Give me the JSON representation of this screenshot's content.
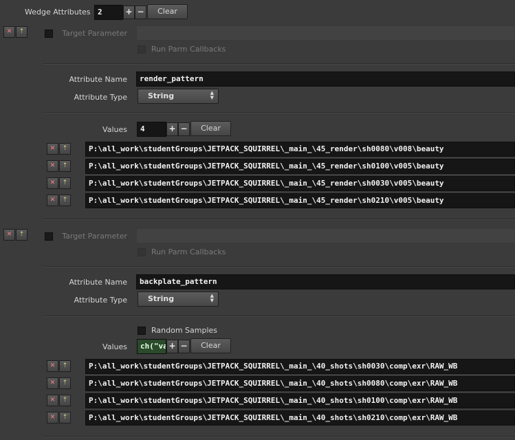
{
  "wedge": {
    "label": "Wedge Attributes",
    "count": "2",
    "clear_label": "Clear",
    "plus": "+",
    "minus": "−"
  },
  "entry_controls": {
    "remove_glyph": "✕",
    "insert_glyph": "⇡"
  },
  "blocks": [
    {
      "target_parameter_label": "Target Parameter",
      "run_callbacks_label": "Run Parm Callbacks",
      "attribute_name_label": "Attribute Name",
      "attribute_name_value": "render_pattern",
      "attribute_type_label": "Attribute Type",
      "attribute_type_value": "String",
      "values_label": "Values",
      "values_count": "4",
      "clear_label": "Clear",
      "values": [
        "P:\\all_work\\studentGroups\\JETPACK_SQUIRREL\\_main_\\45_render\\sh0080\\v008\\beauty",
        "P:\\all_work\\studentGroups\\JETPACK_SQUIRREL\\_main_\\45_render\\sh0100\\v005\\beauty",
        "P:\\all_work\\studentGroups\\JETPACK_SQUIRREL\\_main_\\45_render\\sh0030\\v005\\beauty",
        "P:\\all_work\\studentGroups\\JETPACK_SQUIRREL\\_main_\\45_render\\sh0210\\v005\\beauty"
      ]
    },
    {
      "target_parameter_label": "Target Parameter",
      "run_callbacks_label": "Run Parm Callbacks",
      "attribute_name_label": "Attribute Name",
      "attribute_name_value": "backplate_pattern",
      "attribute_type_label": "Attribute Type",
      "attribute_type_value": "String",
      "random_samples_label": "Random Samples",
      "values_label": "Values",
      "values_count": "ch(\"va",
      "clear_label": "Clear",
      "values": [
        "P:\\all_work\\studentGroups\\JETPACK_SQUIRREL\\_main_\\40_shots\\sh0030\\comp\\exr\\RAW_WB",
        "P:\\all_work\\studentGroups\\JETPACK_SQUIRREL\\_main_\\40_shots\\sh0080\\comp\\exr\\RAW_WB",
        "P:\\all_work\\studentGroups\\JETPACK_SQUIRREL\\_main_\\40_shots\\sh0100\\comp\\exr\\RAW_WB",
        "P:\\all_work\\studentGroups\\JETPACK_SQUIRREL\\_main_\\40_shots\\sh0210\\comp\\exr\\RAW_WB"
      ]
    }
  ]
}
